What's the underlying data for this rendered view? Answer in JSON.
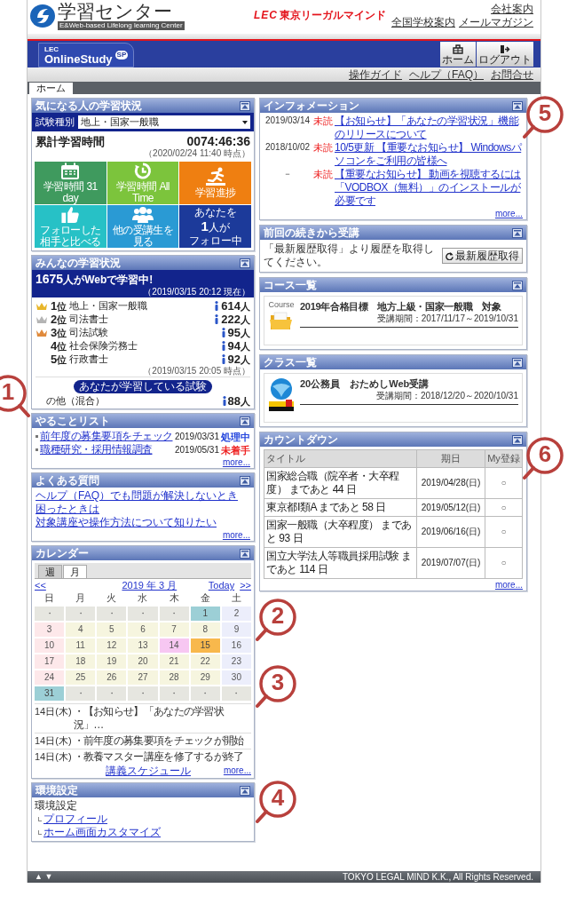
{
  "header": {
    "logo_title": "学習センター",
    "logo_subtitle": "E&Web-based Lifelong learning Center",
    "brand_mark": "LEC",
    "brand_name": "東京リーガルマインド",
    "top_links": [
      {
        "label": "会社案内"
      },
      {
        "label": "全国学校案内"
      },
      {
        "label": "メールマガジン"
      }
    ]
  },
  "banner": {
    "mark": "LEC",
    "name": "OnlineStudy",
    "badge": "SP",
    "buttons": [
      {
        "label": "ホーム"
      },
      {
        "label": "ログアウト"
      }
    ]
  },
  "util_links": [
    {
      "label": "操作ガイド"
    },
    {
      "label": "ヘルプ（FAQ）"
    },
    {
      "label": "お問合せ"
    }
  ],
  "tabs": [
    {
      "label": "ホーム",
      "selected": true
    }
  ],
  "watch": {
    "title": "気になる人の学習状況",
    "filter_label": "試験種別",
    "filter_value": "地上・国家一般職",
    "total_label": "累計学習時間",
    "total_value": "0074:46:36",
    "total_note": "（2020/02/24 11:40 時点）",
    "tiles": [
      {
        "kind": "icon",
        "label": "学習時間 31 day",
        "color": "#3f9a5e"
      },
      {
        "kind": "icon",
        "label": "学習時間 All Time",
        "color": "#7cc43c"
      },
      {
        "kind": "icon",
        "label": "学習進捗",
        "color": "#ef7f11"
      },
      {
        "kind": "icon",
        "label": "フォローした相手と比べる",
        "color": "#27c1c6"
      },
      {
        "kind": "icon",
        "label": "他の受講生を見る",
        "color": "#2a9ad4"
      },
      {
        "kind": "follow",
        "line1": "あなたを",
        "count": "1",
        "unit": "人が",
        "line3": "フォロー中",
        "color": "#1c3a9a"
      }
    ]
  },
  "everyone": {
    "title": "みんなの学習状況",
    "count": "1675",
    "count_suffix": "人がWebで学習中!",
    "as_of": "（2019/03/15 20:12 現在）",
    "ranking": [
      {
        "rank": "1",
        "rank_unit": "位",
        "name": "地上・国家一般職",
        "count": "614",
        "unit": "人",
        "color": "#e8b62a"
      },
      {
        "rank": "2",
        "rank_unit": "位",
        "name": "司法書士",
        "count": "222",
        "unit": "人",
        "color": "#b4b4b4"
      },
      {
        "rank": "3",
        "rank_unit": "位",
        "name": "司法試験",
        "count": "95",
        "unit": "人",
        "color": "#e08a3c"
      },
      {
        "rank": "4",
        "rank_unit": "位",
        "name": "社会保険労務士",
        "count": "94",
        "unit": "人"
      },
      {
        "rank": "5",
        "rank_unit": "位",
        "name": "行政書士",
        "count": "92",
        "unit": "人"
      }
    ],
    "ranking_note": "（2019/03/15 20:05 時点）",
    "mine_label": "あなたが学習している試験",
    "mine": {
      "name": "の他（混合）",
      "count": "88",
      "unit": "人"
    }
  },
  "todo": {
    "title": "やることリスト",
    "items": [
      {
        "title": "前年度の募集要項をチェック",
        "date": "2019/03/31",
        "status": "処理中",
        "color": "#2244dd"
      },
      {
        "title": "職種研究・採用情報調査",
        "date": "2019/05/31",
        "status": "未着手",
        "color": "#ee2222"
      }
    ],
    "more": "more..."
  },
  "faq": {
    "title": "よくある質問",
    "links": [
      "ヘルプ（FAQ）でも問題が解決しないとき",
      "困ったときは",
      "対象講座や操作方法について知りたい"
    ],
    "more": "more..."
  },
  "calendar": {
    "title": "カレンダー",
    "tabs": [
      {
        "label": "週",
        "selected": false
      },
      {
        "label": "月",
        "selected": true
      }
    ],
    "prev": "<<",
    "month": "2019 年 3 月",
    "today": "Today",
    "next": ">>",
    "weekdays": [
      "日",
      "月",
      "火",
      "水",
      "木",
      "金",
      "土"
    ],
    "weeks": [
      [
        {
          "t": "・",
          "kind": "empty"
        },
        {
          "t": "・",
          "kind": "empty"
        },
        {
          "t": "・",
          "kind": "empty"
        },
        {
          "t": "・",
          "kind": "empty"
        },
        {
          "t": "・",
          "kind": "empty"
        },
        {
          "t": "1",
          "kind": "event"
        },
        {
          "t": "2",
          "kind": "saturday"
        }
      ],
      [
        {
          "t": "3",
          "kind": "sunday"
        },
        {
          "t": "4",
          "kind": "weekday"
        },
        {
          "t": "5",
          "kind": "weekday"
        },
        {
          "t": "6",
          "kind": "weekday"
        },
        {
          "t": "7",
          "kind": "weekday"
        },
        {
          "t": "8",
          "kind": "weekday"
        },
        {
          "t": "9",
          "kind": "saturday"
        }
      ],
      [
        {
          "t": "10",
          "kind": "sunday"
        },
        {
          "t": "11",
          "kind": "weekday"
        },
        {
          "t": "12",
          "kind": "weekday"
        },
        {
          "t": "13",
          "kind": "weekday"
        },
        {
          "t": "14",
          "kind": "marked"
        },
        {
          "t": "15",
          "kind": "today"
        },
        {
          "t": "16",
          "kind": "saturday"
        }
      ],
      [
        {
          "t": "17",
          "kind": "sunday"
        },
        {
          "t": "18",
          "kind": "weekday"
        },
        {
          "t": "19",
          "kind": "weekday"
        },
        {
          "t": "20",
          "kind": "weekday"
        },
        {
          "t": "21",
          "kind": "weekday"
        },
        {
          "t": "22",
          "kind": "weekday"
        },
        {
          "t": "23",
          "kind": "saturday"
        }
      ],
      [
        {
          "t": "24",
          "kind": "sunday"
        },
        {
          "t": "25",
          "kind": "weekday"
        },
        {
          "t": "26",
          "kind": "weekday"
        },
        {
          "t": "27",
          "kind": "weekday"
        },
        {
          "t": "28",
          "kind": "weekday"
        },
        {
          "t": "29",
          "kind": "weekday"
        },
        {
          "t": "30",
          "kind": "saturday"
        }
      ],
      [
        {
          "t": "31",
          "kind": "event"
        },
        {
          "t": "・",
          "kind": "empty"
        },
        {
          "t": "・",
          "kind": "empty"
        },
        {
          "t": "・",
          "kind": "empty"
        },
        {
          "t": "・",
          "kind": "empty"
        },
        {
          "t": "・",
          "kind": "empty"
        },
        {
          "t": "・",
          "kind": "empty"
        }
      ]
    ],
    "events": [
      {
        "date": "14日(木)",
        "text": "・【お知らせ】「あなたの学習状況」…"
      },
      {
        "date": "14日(木)",
        "text": "・前年度の募集要項をチェックが開始"
      },
      {
        "date": "14日(木)",
        "text": "・教養マスター講座を修了するが終了"
      }
    ],
    "schedule_link": "講義スケジュール",
    "more": "more..."
  },
  "settings": {
    "title": "環境設定",
    "label": "環境設定",
    "links": [
      "プロフィール",
      "ホーム画面カスタマイズ"
    ]
  },
  "info": {
    "title": "インフォメーション",
    "items": [
      {
        "date": "2019/03/14",
        "badge": "未読",
        "text": "【お知らせ】「あなたの学習状況」機能のリリースについて"
      },
      {
        "date": "2018/10/02",
        "badge": "未読",
        "text": "10/5更新 【重要なお知らせ】 Windowsパソコンをご利用の皆様へ"
      },
      {
        "date": "－",
        "badge": "未読",
        "text": "【重要なお知らせ】 動画を視聴するには「VODBOX（無料）」のインストールが必要です"
      }
    ],
    "more": "more..."
  },
  "resume": {
    "title": "前回の続きから受講",
    "message": "「最新履歴取得」より履歴を取得してください。",
    "button": "最新履歴取得"
  },
  "courses": {
    "title": "コース一覧",
    "items": [
      {
        "tag": "Course",
        "name": "2019年合格目標　地方上級・国家一般職　対象",
        "period": "受講期間：2017/11/17～2019/10/31"
      }
    ]
  },
  "classes": {
    "title": "クラス一覧",
    "items": [
      {
        "name": "20公務員　おためしWeb受講",
        "period": "受講期間：2018/12/20～2020/10/31"
      }
    ]
  },
  "countdown": {
    "title": "カウントダウン",
    "columns": [
      "タイトル",
      "期日",
      "My登録"
    ],
    "rows": [
      {
        "title": "国家総合職（院卒者・大卒程度） まであと 44 日",
        "date": "2019/04/28(日)",
        "mark": "○"
      },
      {
        "title": "東京都Ⅰ類A まであと 58 日",
        "date": "2019/05/12(日)",
        "mark": "○"
      },
      {
        "title": "国家一般職（大卒程度） まであと 93 日",
        "date": "2019/06/16(日)",
        "mark": "○"
      },
      {
        "title": "国立大学法人等職員採用試験 まであと 114 日",
        "date": "2019/07/07(日)",
        "mark": "○"
      }
    ],
    "more": "more..."
  },
  "footer": {
    "arrows": "▲ ▼",
    "copyright": "TOKYO LEGAL MIND K.K., All Rights Reserved."
  },
  "callouts": [
    {
      "number": "1"
    },
    {
      "number": "2"
    },
    {
      "number": "3"
    },
    {
      "number": "4"
    },
    {
      "number": "5"
    },
    {
      "number": "6"
    }
  ]
}
